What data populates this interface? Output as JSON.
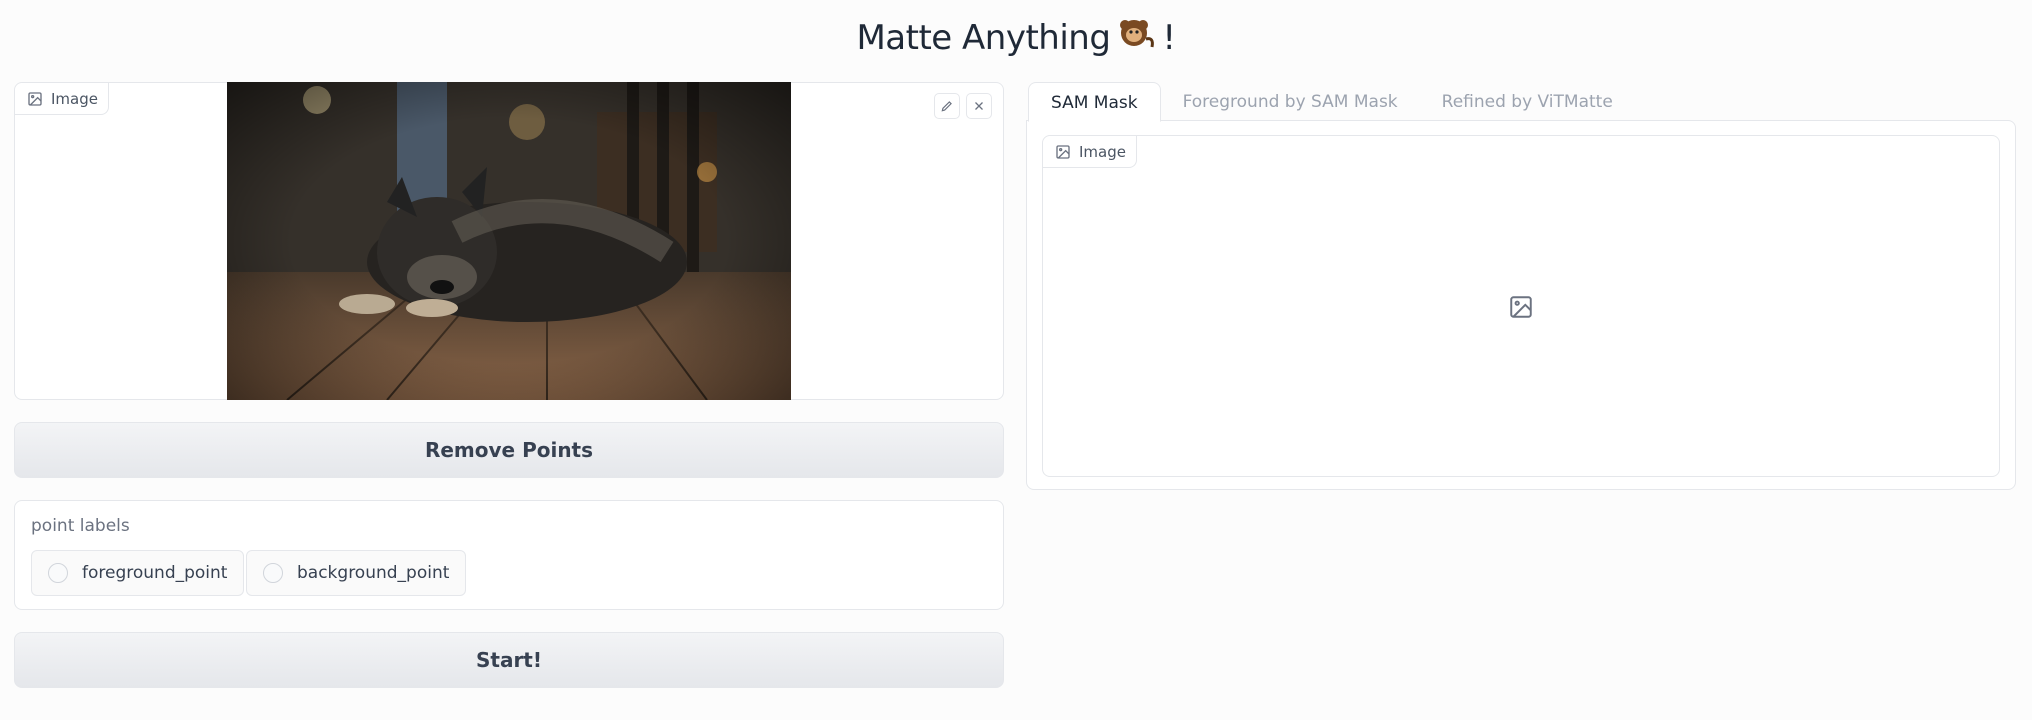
{
  "app": {
    "title": "Matte Anything",
    "title_suffix": "!"
  },
  "input_image": {
    "label": "Image",
    "label_icon": "image-icon",
    "edit_icon": "pencil-icon",
    "clear_icon": "close-icon"
  },
  "buttons": {
    "remove_points": "Remove Points",
    "start": "Start!"
  },
  "point_labels": {
    "label": "point labels",
    "options": [
      "foreground_point",
      "background_point"
    ]
  },
  "tabs": [
    {
      "label": "SAM Mask",
      "active": true
    },
    {
      "label": "Foreground by SAM Mask",
      "active": false
    },
    {
      "label": "Refined by ViTMatte",
      "active": false
    }
  ],
  "output_image": {
    "label": "Image",
    "placeholder_icon": "image-placeholder-icon"
  },
  "colors": {
    "background": "#fcfcfc",
    "border": "#e5e7eb",
    "button_bg": "#e5e7eb",
    "text": "#1f2937",
    "muted": "#9ca3af"
  }
}
